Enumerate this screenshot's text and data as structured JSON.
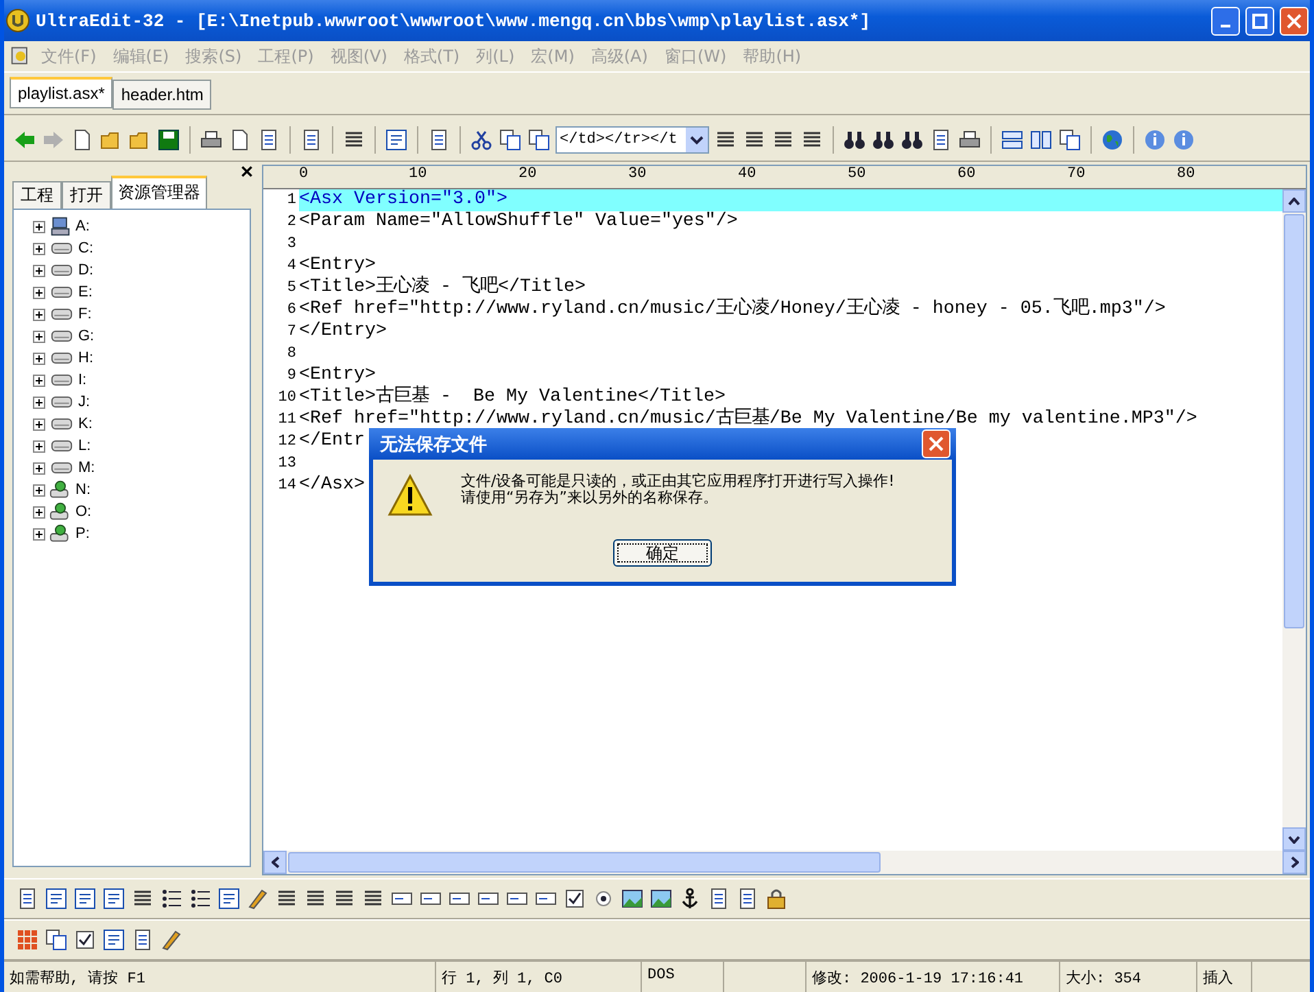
{
  "window": {
    "title": "UltraEdit-32 - [E:\\Inetpub.wwwroot\\wwwroot\\www.mengq.cn\\bbs\\wmp\\playlist.asx*]"
  },
  "menu": [
    {
      "label": "文件(F)",
      "disabled": true
    },
    {
      "label": "编辑(E)",
      "disabled": true
    },
    {
      "label": "搜索(S)",
      "disabled": true
    },
    {
      "label": "工程(P)",
      "disabled": true
    },
    {
      "label": "视图(V)",
      "disabled": true
    },
    {
      "label": "格式(T)",
      "disabled": true
    },
    {
      "label": "列(L)",
      "disabled": true
    },
    {
      "label": "宏(M)",
      "disabled": true
    },
    {
      "label": "高级(A)",
      "disabled": true
    },
    {
      "label": "窗口(W)",
      "disabled": true
    },
    {
      "label": "帮助(H)",
      "disabled": true
    }
  ],
  "file_tabs": [
    {
      "label": "playlist.asx*",
      "selected": true
    },
    {
      "label": "header.htm",
      "selected": false
    }
  ],
  "toolbar": {
    "combo_value": "</td></tr></t"
  },
  "side_panel": {
    "tabs": [
      {
        "label": "工程",
        "selected": false
      },
      {
        "label": "打开",
        "selected": false
      },
      {
        "label": "资源管理器",
        "selected": true
      }
    ],
    "tree": [
      {
        "label": "A:",
        "kind": "floppy",
        "expanded": false
      },
      {
        "label": "C:",
        "kind": "disk",
        "expanded": false
      },
      {
        "label": "D:",
        "kind": "disk",
        "expanded": false
      },
      {
        "label": "E:",
        "kind": "disk",
        "expanded": false
      },
      {
        "label": "F:",
        "kind": "disk",
        "expanded": false
      },
      {
        "label": "G:",
        "kind": "disk",
        "expanded": false
      },
      {
        "label": "H:",
        "kind": "disk",
        "expanded": false
      },
      {
        "label": "I:",
        "kind": "disk",
        "expanded": false
      },
      {
        "label": "J:",
        "kind": "disk",
        "expanded": false
      },
      {
        "label": "K:",
        "kind": "disk",
        "expanded": false
      },
      {
        "label": "L:",
        "kind": "disk",
        "expanded": false
      },
      {
        "label": "M:",
        "kind": "disk",
        "expanded": false
      },
      {
        "label": "N:",
        "kind": "network",
        "expanded": false
      },
      {
        "label": "O:",
        "kind": "network",
        "expanded": false
      },
      {
        "label": "P:",
        "kind": "network",
        "expanded": false
      }
    ]
  },
  "editor": {
    "ruler": [
      "0",
      "10",
      "20",
      "30",
      "40",
      "50",
      "60",
      "70",
      "80"
    ],
    "lines": [
      {
        "number": "1",
        "text": "<Asx Version=\"3.0\">",
        "current": true
      },
      {
        "number": "2",
        "text": "<Param Name=\"AllowShuffle\" Value=\"yes\"/>",
        "current": false
      },
      {
        "number": "3",
        "current": false
      },
      {
        "number": "4",
        "text": "<Entry>",
        "current": false
      },
      {
        "number": "5",
        "text": "<Title>王心凌 - 飞吧</Title>",
        "current": false
      },
      {
        "number": "6",
        "text": "<Ref href=\"http://www.ryland.cn/music/王心凌/Honey/王心凌 - honey - 05.飞吧.mp3\"/>",
        "current": false
      },
      {
        "number": "7",
        "text": "</Entry>",
        "current": false
      },
      {
        "number": "8",
        "current": false
      },
      {
        "number": "9",
        "text": "<Entry>",
        "current": false
      },
      {
        "number": "10",
        "text": "<Title>古巨基 -  Be My Valentine</Title>",
        "current": false
      },
      {
        "number": "11",
        "text": "<Ref href=\"http://www.ryland.cn/music/古巨基/Be My Valentine/Be my valentine.MP3\"/>",
        "current": false
      },
      {
        "number": "12",
        "text": "</Entr",
        "current": false
      },
      {
        "number": "13",
        "current": false
      },
      {
        "number": "14",
        "text": "</Asx>",
        "current": false
      }
    ]
  },
  "dialog": {
    "title": "无法保存文件",
    "message": [
      "文件/设备可能是只读的，或正由其它应用程序打开进行写入操作!",
      "请使用“另存为”来以另外的名称保存。"
    ],
    "button": "确定"
  },
  "status_bar": [
    "如需帮助, 请按 F1",
    "行 1, 列 1, C0",
    "DOS",
    "修改: 2006-1-19 17:16:41",
    "大小: 354",
    "插入"
  ]
}
